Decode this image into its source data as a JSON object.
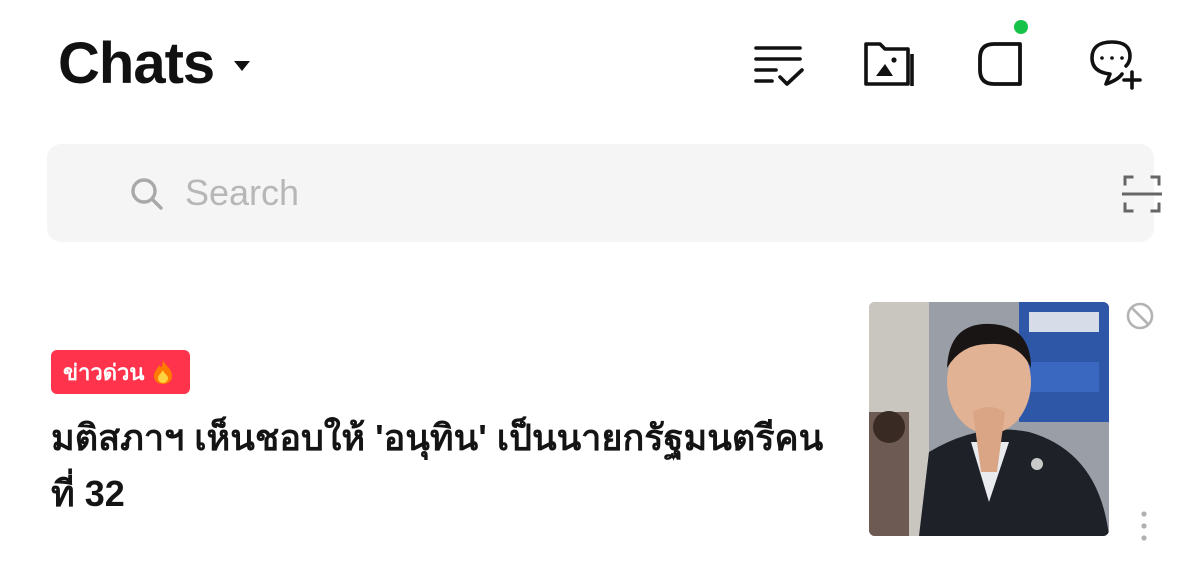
{
  "header": {
    "title": "Chats",
    "icons": [
      "edit-list-icon",
      "album-icon",
      "story-icon",
      "new-chat-icon"
    ],
    "notification_dot_color": "#17c249"
  },
  "search": {
    "placeholder": "Search",
    "value": ""
  },
  "news": {
    "badge_label": "ข่าวด่วน",
    "badge_color": "#ff334b",
    "headline": "มติสภาฯ เห็นชอบให้ 'อนุทิน' เป็นนายกรัฐมนตรีคนที่ 32"
  }
}
